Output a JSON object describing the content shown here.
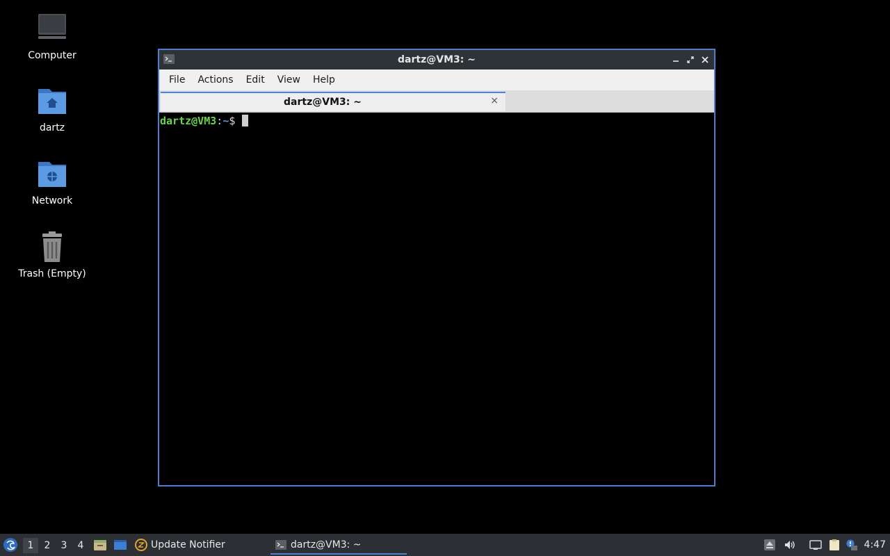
{
  "desktop": {
    "icons": [
      {
        "label": "Computer",
        "icon": "computer-icon"
      },
      {
        "label": "dartz",
        "icon": "home-folder-icon"
      },
      {
        "label": "Network",
        "icon": "network-folder-icon"
      },
      {
        "label": "Trash (Empty)",
        "icon": "trash-icon"
      }
    ]
  },
  "window": {
    "title": "dartz@VM3: ~",
    "menu": [
      "File",
      "Actions",
      "Edit",
      "View",
      "Help"
    ],
    "tab": {
      "label": "dartz@VM3: ~",
      "close": "×"
    },
    "terminal": {
      "user_host": "dartz@VM3",
      "colon": ":",
      "path": "~",
      "dollar": "$"
    }
  },
  "taskbar": {
    "workspaces": [
      "1",
      "2",
      "3",
      "4"
    ],
    "active_workspace": "1",
    "tasks": [
      {
        "label": "Update Notifier",
        "icon": "update-notifier-icon",
        "active": false
      },
      {
        "label": "dartz@VM3: ~",
        "icon": "terminal-icon",
        "active": true
      }
    ],
    "clock": "4:47"
  },
  "colors": {
    "accent": "#4a86d8",
    "prompt_user": "#69d54a",
    "prompt_path": "#6a8fd6",
    "taskbar_bg": "#2c3034"
  }
}
